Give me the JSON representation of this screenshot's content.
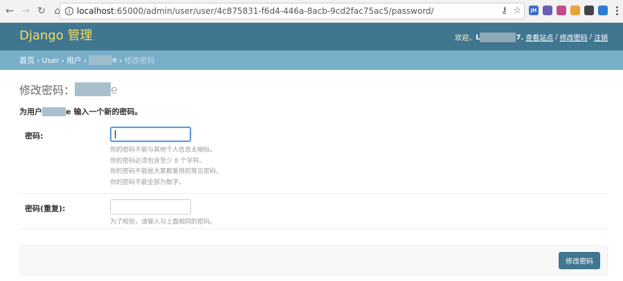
{
  "browser": {
    "url_host": "localhost",
    "url_rest": ":65000/admin/user/user/4c875831-f6d4-446a-8acb-9cd2fac75ac5/password/",
    "extensions": [
      {
        "label": "JH",
        "color": "#3b6fc9"
      },
      {
        "label": "",
        "color": "#6b5fb5"
      },
      {
        "label": "",
        "color": "#c44b8a"
      },
      {
        "label": "",
        "color": "#e8a33a"
      },
      {
        "label": "",
        "color": "#444444"
      },
      {
        "label": "",
        "color": "#2b7ad8"
      }
    ]
  },
  "header": {
    "branding": "Django 管理",
    "welcome": "欢迎，",
    "username_start": "L",
    "username_end": "7.",
    "view_site": "查看站点",
    "change_password": "修改密码",
    "logout": "注销",
    "separator": "/"
  },
  "breadcrumbs": {
    "home": "首页",
    "app": "User",
    "model": "用户",
    "object_end": "e",
    "current": "修改密码",
    "arrow": "›"
  },
  "content": {
    "title_prefix": "修改密码：",
    "title_end": "e",
    "intro_prefix": "为用户",
    "intro_user_end": "e",
    "intro_suffix": "输入一个新的密码。",
    "password1": {
      "label": "密码:",
      "value": "",
      "help": [
        "你的密码不能与其他个人信息太相似。",
        "你的密码必须包含至少 8 个字符。",
        "你的密码不能是大家都爱用的常见密码。",
        "你的密码不能全部为数字。"
      ]
    },
    "password2": {
      "label": "密码(重复):",
      "value": "",
      "help": "为了校验，请输入与上面相同的密码。"
    },
    "submit_label": "修改密码"
  },
  "colors": {
    "header_bg": "#417690",
    "branding": "#f5dd5d",
    "breadcrumb_bg": "#79aec8",
    "button_bg": "#417690"
  }
}
